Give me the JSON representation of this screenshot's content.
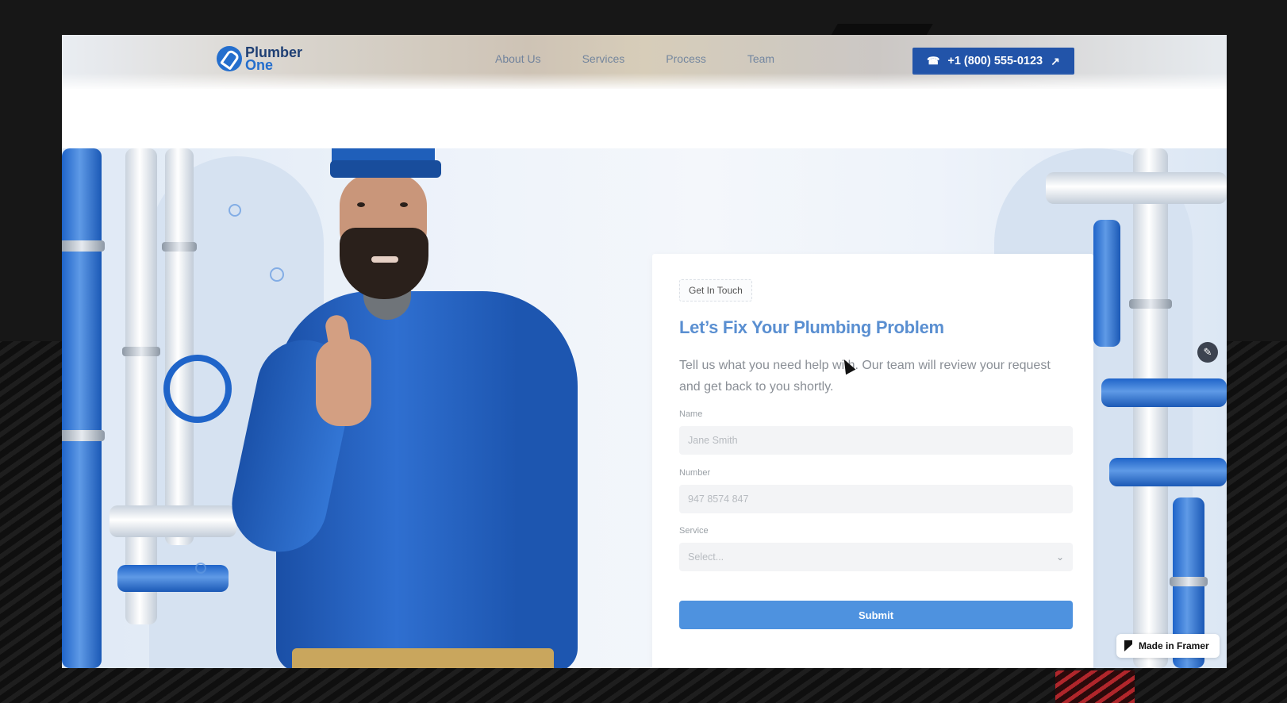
{
  "header": {
    "logo": {
      "line1": "Plumber",
      "line2": "One"
    },
    "nav": [
      "About Us",
      "Services",
      "Process",
      "Team"
    ],
    "phone_button": {
      "icon": "phone-icon",
      "label": "+1 (800) 555-0123",
      "arrow": "↗"
    }
  },
  "form": {
    "badge": "Get In Touch",
    "title": "Let’s Fix Your Plumbing Problem",
    "description": "Tell us what you need help with. Our team will review your request and get back to you shortly.",
    "name_label": "Name",
    "name_placeholder": "Jane Smith",
    "number_label": "Number",
    "number_placeholder": "947 8574 847",
    "service_label": "Service",
    "service_value": "Select...",
    "submit_label": "Submit"
  },
  "framer_badge": "Made in Framer",
  "colors": {
    "primary": "#1d55b3",
    "accent": "#4e92df",
    "title": "#5a8fd1",
    "frame_bg": "#171717"
  }
}
